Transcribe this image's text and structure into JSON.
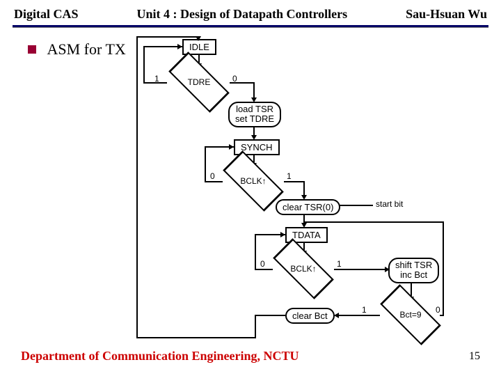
{
  "header": {
    "left": "Digital CAS",
    "center": "Unit 4 : Design of Datapath Controllers",
    "right": "Sau-Hsuan Wu"
  },
  "bullet": "ASM for TX",
  "asm": {
    "idle": "IDLE",
    "tdre": "TDRE",
    "load1": "load TSR",
    "load2": "set TDRE",
    "synch": "SYNCH",
    "bclk": "BCLK↑",
    "cleartsr": "clear TSR(0)",
    "startbit": "start bit",
    "tdata": "TDATA",
    "shift1": "shift TSR",
    "shift2": "inc Bct",
    "bct9": "Bct=9",
    "clearbct": "clear Bct",
    "one": "1",
    "zero": "0"
  },
  "footer": {
    "dept": "Department of Communication Engineering, NCTU",
    "page": "15"
  }
}
